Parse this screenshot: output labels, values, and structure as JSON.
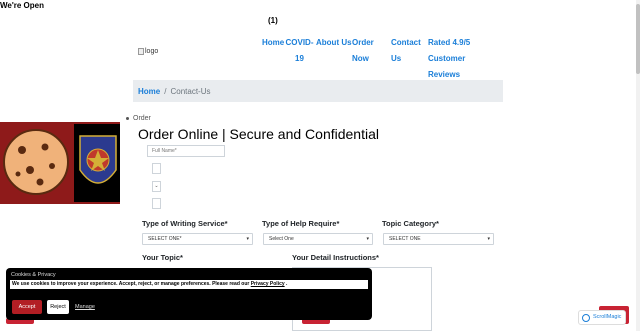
{
  "banner": {
    "open_text": "We're Open"
  },
  "cart": {
    "count": "(1)"
  },
  "logo": {
    "alt_text": "logo"
  },
  "nav": {
    "home": "Home",
    "covid": "COVID-19",
    "about": "About Us",
    "order": "Order Now",
    "contact": "Contact Us",
    "rated": "Rated 4.9/5 Customer Reviews"
  },
  "breadcrumb": {
    "home": "Home",
    "separator": "/",
    "current": "Contact-Us"
  },
  "sidebar_list": {
    "order": "Order"
  },
  "page": {
    "title": "Order Online | Secure and Confidential"
  },
  "form": {
    "fullname_placeholder": "Full Name*",
    "mini_fields": [
      " ",
      "⌄",
      " "
    ],
    "labels": {
      "writing_service": "Type of Writing Service*",
      "help_require": "Type of Help Require*",
      "topic_category": "Topic Category*",
      "your_topic": "Your Topic*",
      "detail_instructions": "Your Detail Instructions*"
    },
    "selects": {
      "writing_service": "SELECT ONE*",
      "help_require": "Select One",
      "topic_category": "SELECT ONE"
    }
  },
  "cookie": {
    "title": "Cookies & Privacy",
    "text": "We use cookies to improve your experience. Accept, reject, or manage preferences. Please read our",
    "link": "Privacy Policy",
    "accept": "Accept",
    "reject": "Reject",
    "manage": "Manage"
  },
  "badge": {
    "text": "ScrollMagic"
  },
  "colors": {
    "link": "#1a7ed8",
    "accent_red": "#c82333",
    "breadcrumb_bg": "#e9ecef",
    "cookie_bg": "#000000"
  }
}
